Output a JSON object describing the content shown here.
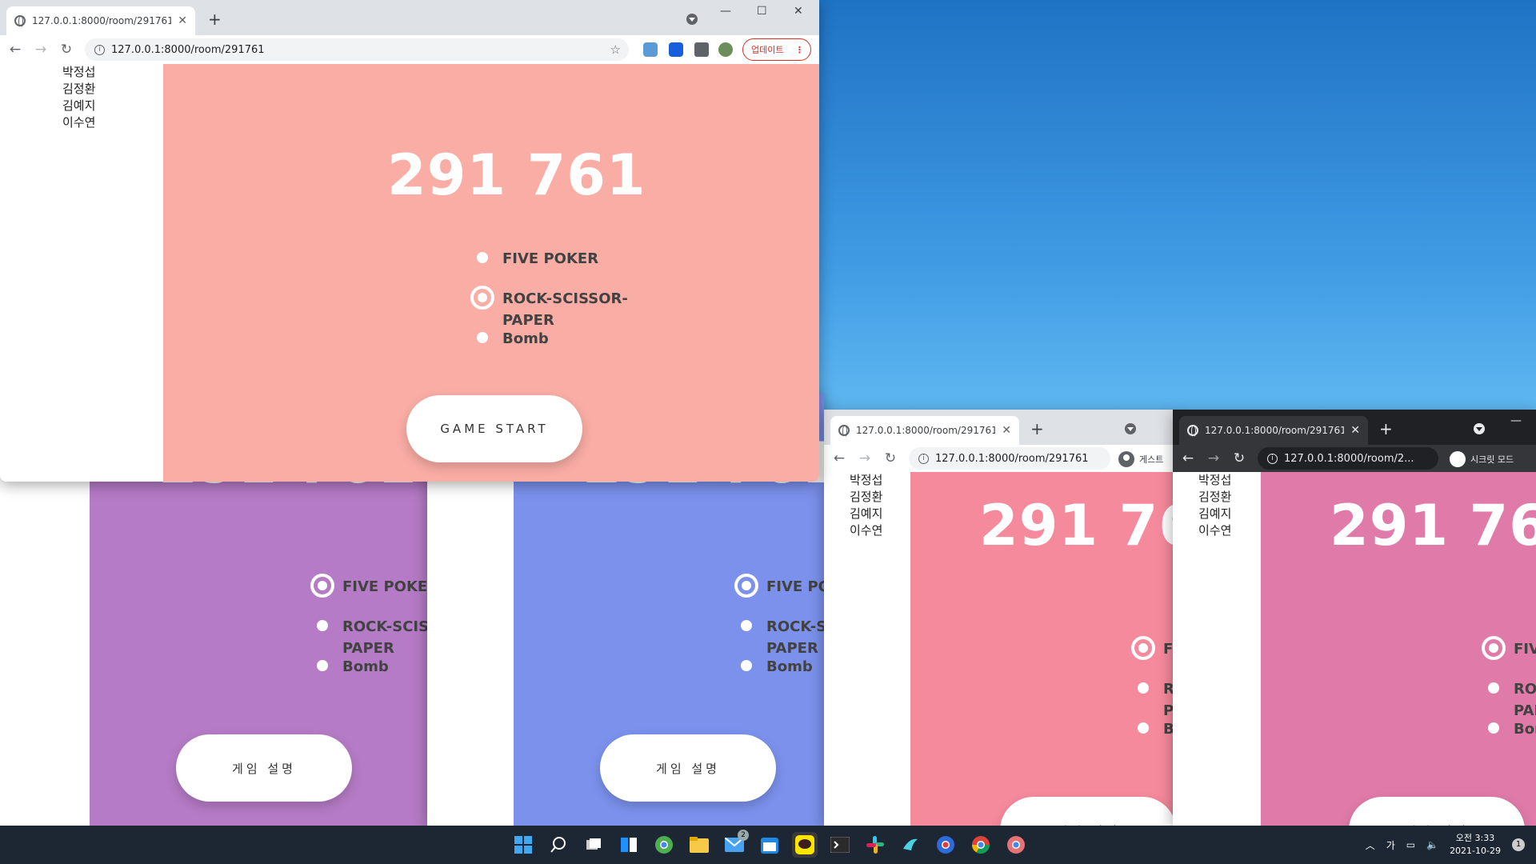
{
  "url": "127.0.0.1:8000/room/291761",
  "url_truncated": "127.0.0.1:8000/room/2...",
  "tab_title": "127.0.0.1:8000/room/291761",
  "room_code": "291 761",
  "players": [
    "박정섭",
    "김정환",
    "김예지",
    "이수연"
  ],
  "games": [
    {
      "label_line1": "FIVE POKER",
      "label_line2": ""
    },
    {
      "label_line1": "ROCK-SCISSOR-",
      "label_line2": "PAPER"
    },
    {
      "label_line1": "Bomb",
      "label_line2": ""
    }
  ],
  "buttons": {
    "game_start": "GAME START",
    "game_rules": "게임 설명"
  },
  "chrome": {
    "update_label": "업데이트",
    "guest_label": "게스트",
    "incognito_label": "시크릿 모드"
  },
  "windows": [
    {
      "id": "main",
      "panel_color": "#f9ada4",
      "selected_game": 1
    },
    {
      "id": "purple",
      "panel_color": "#b57bc6",
      "selected_game": 0
    },
    {
      "id": "blue",
      "panel_color": "#7b91ec",
      "selected_game": 0
    },
    {
      "id": "guest",
      "panel_color": "#f58a9c",
      "selected_game": 0
    },
    {
      "id": "incognito",
      "panel_color": "#e07aa9",
      "selected_game": 0
    }
  ],
  "taskbar": {
    "icons": [
      "windows-start-icon",
      "search-icon",
      "task-view-icon",
      "widgets-icon",
      "chrome-dev-icon",
      "file-explorer-icon",
      "mail-icon",
      "calendar-icon",
      "kakaotalk-icon",
      "terminal-icon",
      "slack-icon",
      "bird-app-icon",
      "chrome-canary-icon",
      "chrome-icon",
      "chrome-beta-icon"
    ],
    "mail_badge": "2",
    "ime": "가",
    "clock_time": "오전 3:33",
    "clock_date": "2021-10-29",
    "notification_count": "1"
  }
}
